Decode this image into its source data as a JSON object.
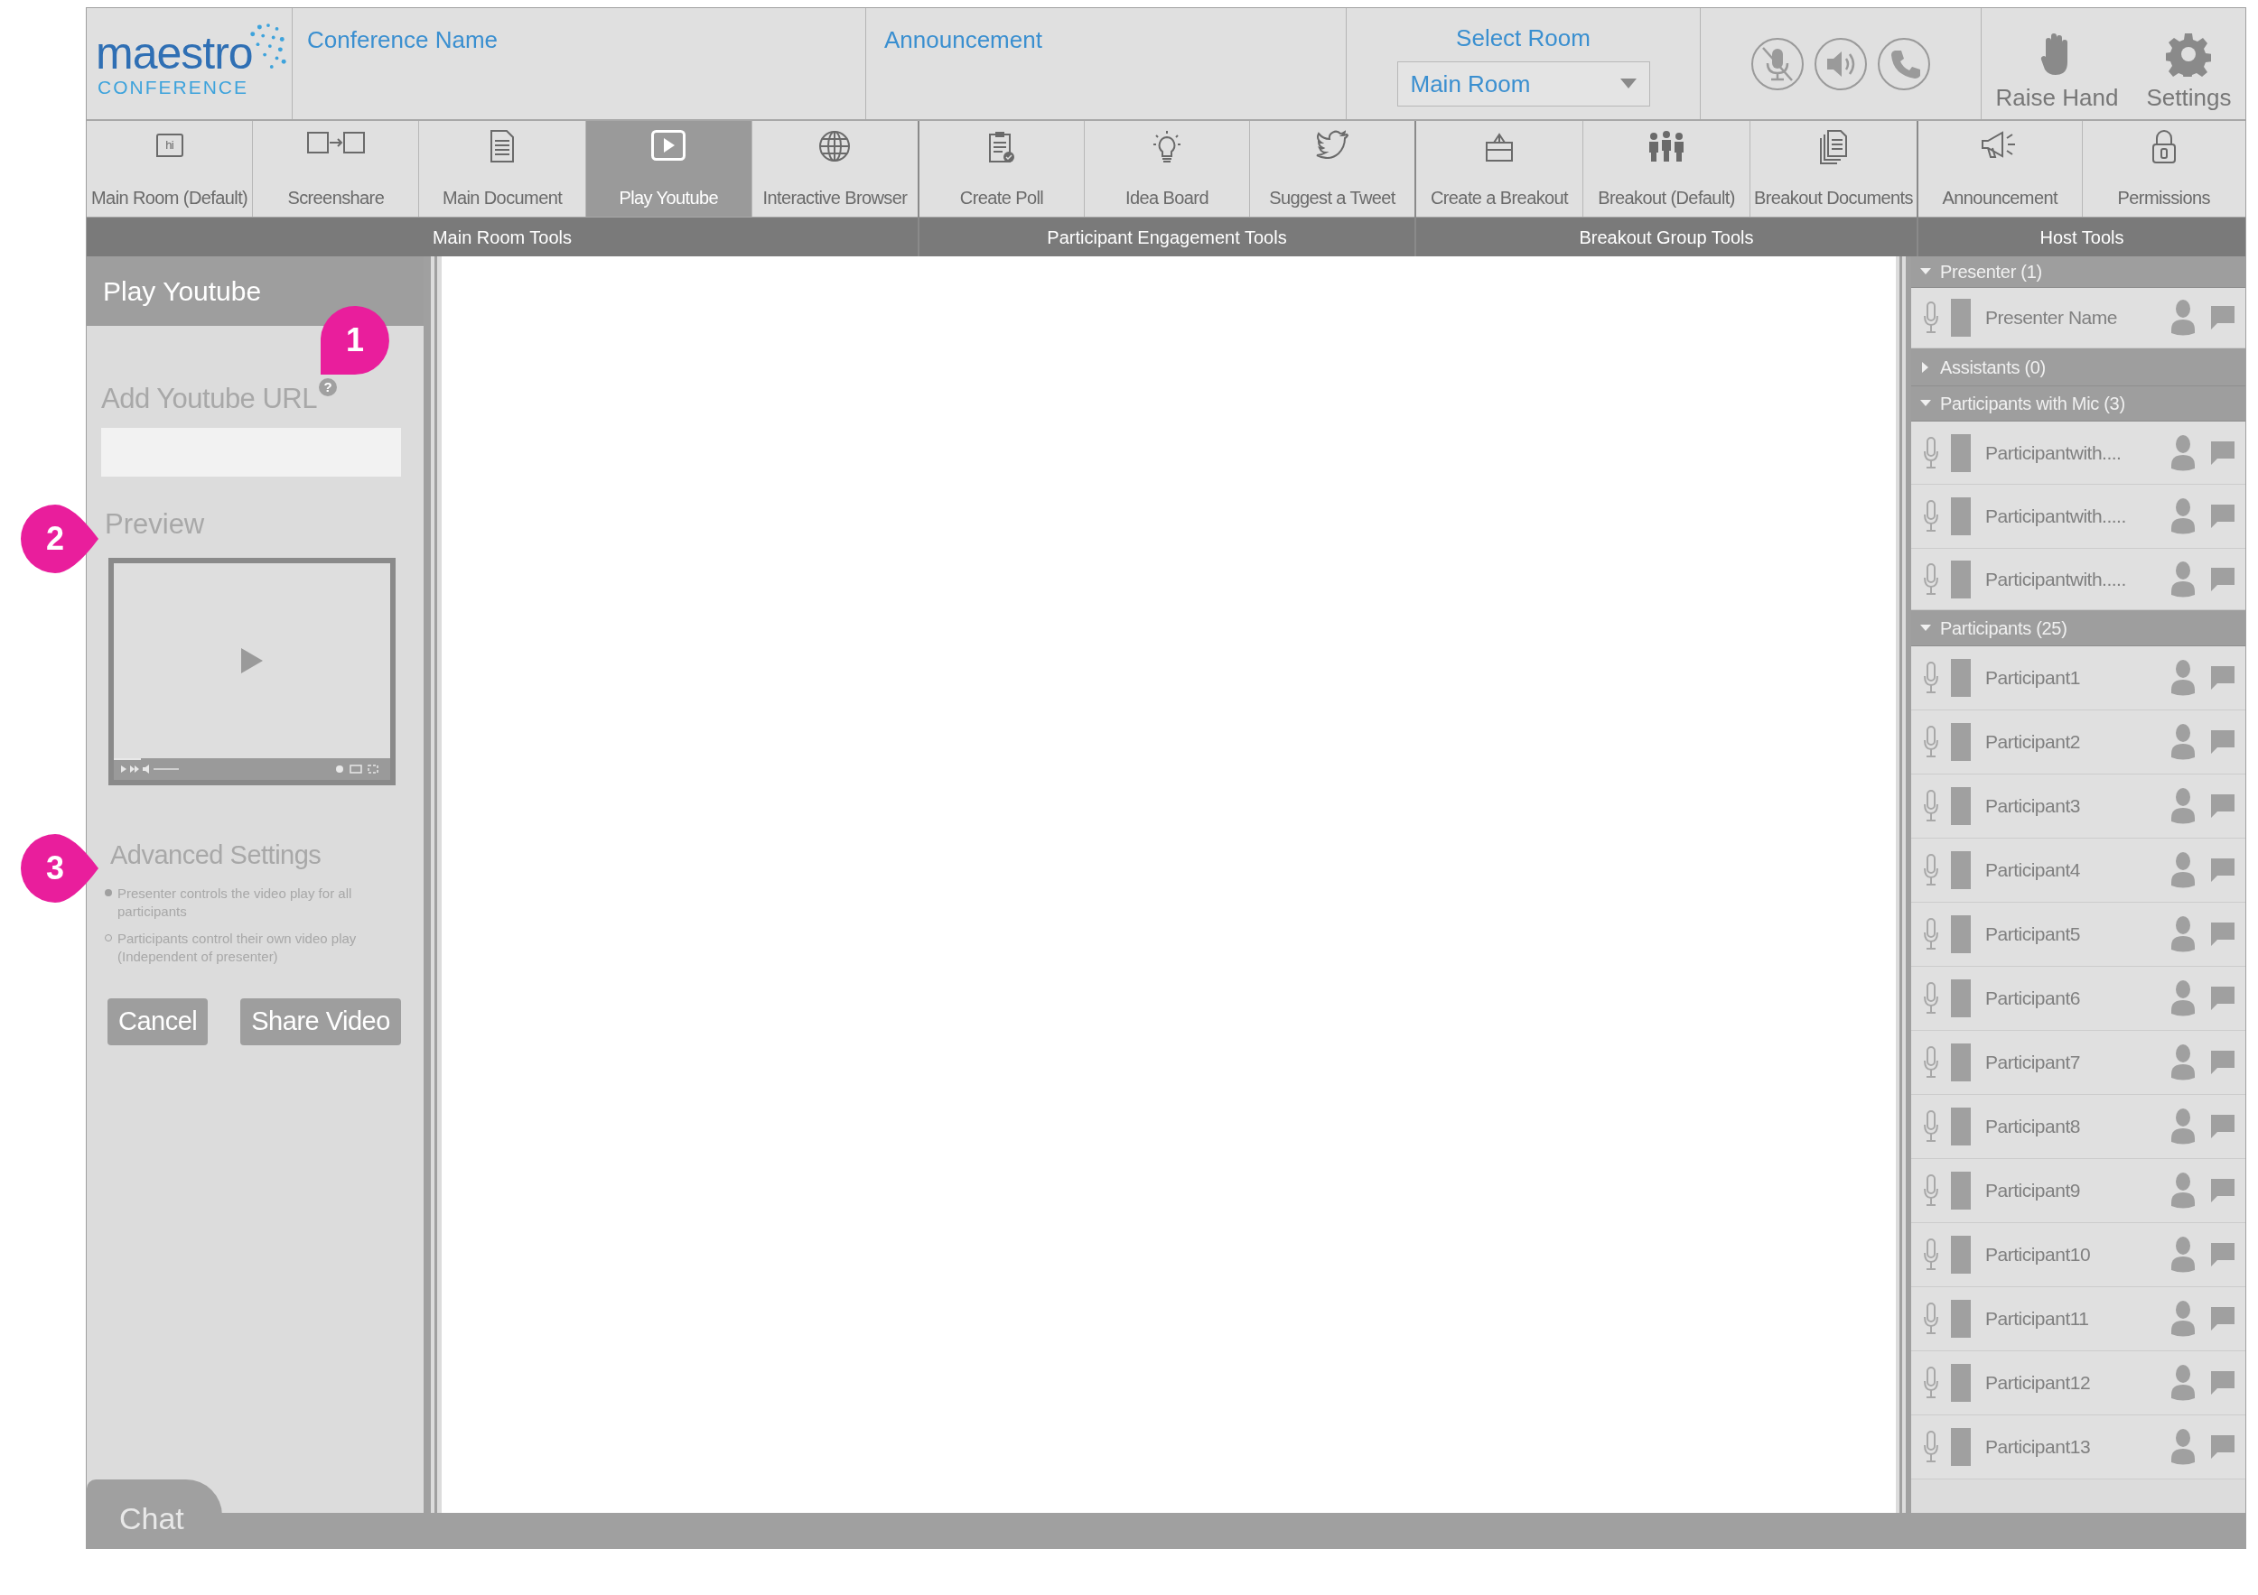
{
  "logo": {
    "wordmark": "maestro",
    "subtitle": "CONFERENCE"
  },
  "header": {
    "conference_name": "Conference Name",
    "announcement": "Announcement",
    "room_select": {
      "label": "Select Room",
      "value": "Main Room"
    },
    "mic_muted": true,
    "actions": [
      "Raise Hand",
      "Settings"
    ]
  },
  "tool_groups": [
    {
      "label": "Main Room Tools",
      "tools": [
        {
          "label": "Main Room (Default)",
          "icon_text": "hi",
          "selected": false
        },
        {
          "label": "Screenshare",
          "selected": false
        },
        {
          "label": "Main Document",
          "selected": false
        },
        {
          "label": "Play Youtube",
          "selected": true
        },
        {
          "label": "Interactive Browser",
          "selected": false
        }
      ]
    },
    {
      "label": "Participant Engagement Tools",
      "tools": [
        {
          "label": "Create Poll",
          "selected": false
        },
        {
          "label": "Idea Board",
          "selected": false
        },
        {
          "label": "Suggest a Tweet",
          "selected": false
        }
      ]
    },
    {
      "label": "Breakout Group Tools",
      "tools": [
        {
          "label": "Create a Breakout",
          "selected": false
        },
        {
          "label": "Breakout (Default)",
          "selected": false
        },
        {
          "label": "Breakout Documents",
          "selected": false
        }
      ]
    },
    {
      "label": "Host Tools",
      "tools": [
        {
          "label": "Announcement",
          "selected": false
        },
        {
          "label": "Permissions",
          "selected": false
        }
      ]
    }
  ],
  "left_panel": {
    "title": "Play Youtube",
    "url_label": "Add Youtube URL",
    "help": "?",
    "preview_label": "Preview",
    "advanced_title": "Advanced Settings",
    "options": [
      {
        "label": "Presenter controls the video play for all participants",
        "selected": true
      },
      {
        "label": "Participants control their own video play (Independent of presenter)",
        "selected": false
      }
    ],
    "buttons": [
      "Cancel",
      "Share Video"
    ]
  },
  "annotations": [
    "1",
    "2",
    "3"
  ],
  "chat_tab": "Chat",
  "roster": [
    {
      "title": "Presenter (1)",
      "expanded": true,
      "members": [
        "Presenter Name"
      ]
    },
    {
      "title": "Assistants (0)",
      "expanded": false
    },
    {
      "title": "Participants with Mic (3)",
      "expanded": true,
      "members": [
        "Participantwith....",
        "Participantwith.....",
        "Participantwith....."
      ]
    },
    {
      "title": "Participants (25)",
      "expanded": true,
      "members": [
        "Participant1",
        "Participant2",
        "Participant3",
        "Participant4",
        "Participant5",
        "Participant6",
        "Participant7",
        "Participant8",
        "Participant9",
        "Participant10",
        "Participant11",
        "Participant12",
        "Participant13"
      ]
    }
  ]
}
